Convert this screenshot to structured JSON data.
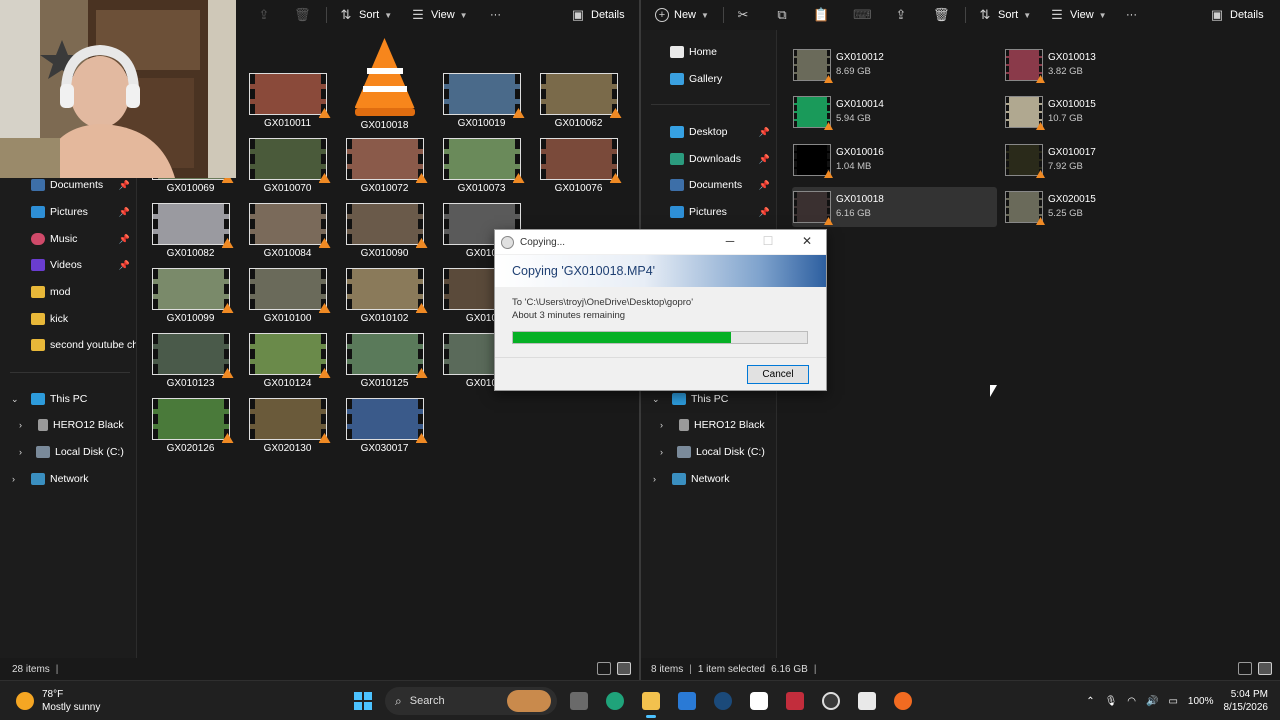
{
  "left_window": {
    "toolbar": {
      "sort_label": "Sort",
      "view_label": "View",
      "more_label": "···",
      "details_label": "Details"
    },
    "nav": [
      {
        "label": "Documents",
        "icon": "documents-icon",
        "pinned": true
      },
      {
        "label": "Pictures",
        "icon": "pictures-icon",
        "pinned": true
      },
      {
        "label": "Music",
        "icon": "music-icon",
        "pinned": true
      },
      {
        "label": "Videos",
        "icon": "videos-icon",
        "pinned": true
      },
      {
        "label": "mod",
        "icon": "folder-icon",
        "pinned": false
      },
      {
        "label": "kick",
        "icon": "folder-icon",
        "pinned": false
      },
      {
        "label": "second youtube cha",
        "icon": "folder-icon",
        "pinned": false
      }
    ],
    "tree": {
      "this_pc": "This PC",
      "hero": "HERO12 Black",
      "local_disk": "Local Disk (C:)",
      "network": "Network"
    },
    "files": [
      "GX010011",
      "GX010018",
      "GX010019",
      "GX010062",
      "GX010069",
      "GX010070",
      "GX010072",
      "GX010073",
      "GX010076",
      "GX010082",
      "GX010084",
      "GX010090",
      "GX010",
      "GX010099",
      "GX010100",
      "GX010102",
      "GX010",
      "GX010123",
      "GX010124",
      "GX010125",
      "GX010",
      "GX020126",
      "GX020130",
      "GX030017"
    ],
    "status": {
      "items": "28 items"
    }
  },
  "right_window": {
    "toolbar": {
      "new_label": "New",
      "sort_label": "Sort",
      "view_label": "View",
      "more_label": "···",
      "details_label": "Details"
    },
    "nav": [
      {
        "label": "Home",
        "icon": "home-icon"
      },
      {
        "label": "Gallery",
        "icon": "gallery-icon"
      },
      {
        "label": "Desktop",
        "icon": "desktop-icon"
      },
      {
        "label": "Downloads",
        "icon": "downloads-icon"
      },
      {
        "label": "Documents",
        "icon": "documents-icon"
      },
      {
        "label": "Pictures",
        "icon": "pictures-icon"
      }
    ],
    "tree": {
      "this_pc": "This PC",
      "hero": "HERO12 Black",
      "local_disk": "Local Disk (C:)",
      "network": "Network"
    },
    "files": [
      {
        "name": "GX010012",
        "size": "8.69 GB"
      },
      {
        "name": "GX010013",
        "size": "3.82 GB"
      },
      {
        "name": "GX010014",
        "size": "5.94 GB"
      },
      {
        "name": "GX010015",
        "size": "10.7 GB"
      },
      {
        "name": "GX010016",
        "size": "1.04 MB"
      },
      {
        "name": "GX010017",
        "size": "7.92 GB"
      },
      {
        "name": "GX010018",
        "size": "6.16 GB"
      },
      {
        "name": "GX020015",
        "size": "5.25 GB"
      }
    ],
    "status": {
      "items": "8 items",
      "selected": "1 item selected",
      "size": "6.16 GB"
    }
  },
  "copy_dialog": {
    "title": "Copying...",
    "heading": "Copying 'GX010018.MP4'",
    "destination": "To 'C:\\Users\\troyj\\OneDrive\\Desktop\\gopro'",
    "remaining": "About 3 minutes remaining",
    "progress": 0.74,
    "cancel_label": "Cancel"
  },
  "taskbar": {
    "weather_temp": "78°F",
    "weather_text": "Mostly sunny",
    "search_label": "Search",
    "battery": "100%",
    "time": "5:04 PM",
    "date": "8/15/2026"
  },
  "colors": {
    "accent": "#4cc2ff",
    "progress_green": "#06b025",
    "vlc_orange": "#f7861c"
  }
}
